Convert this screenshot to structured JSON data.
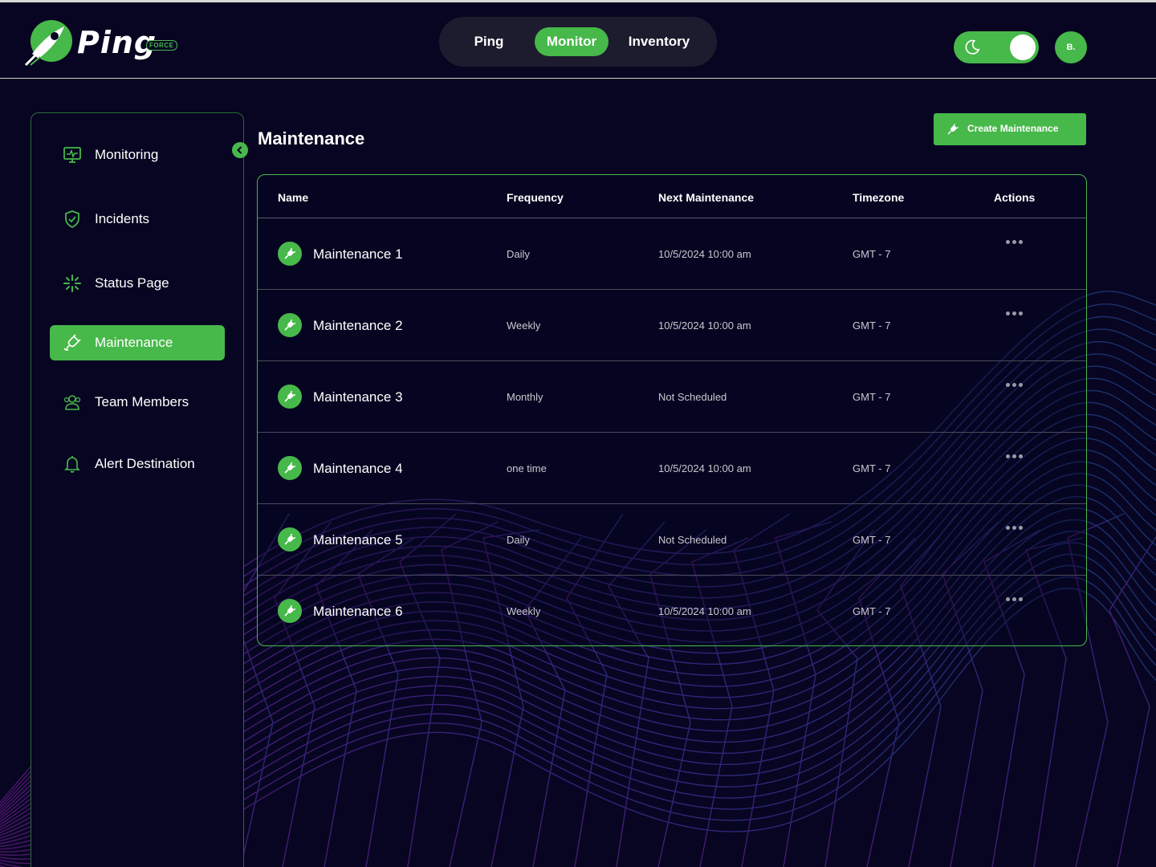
{
  "brand": {
    "name": "Ping",
    "tag": "FORCE",
    "accent": "#47b84a",
    "background": "#070521"
  },
  "nav": {
    "tabs": [
      {
        "label": "Ping",
        "active": false
      },
      {
        "label": "Monitor",
        "active": true
      },
      {
        "label": "Inventory",
        "active": false
      }
    ]
  },
  "theme_toggle": {
    "icon": "moon-icon",
    "state": "on"
  },
  "user": {
    "initial": "B."
  },
  "sidebar": {
    "items": [
      {
        "label": "Monitoring",
        "icon": "monitor-icon",
        "active": false
      },
      {
        "label": "Incidents",
        "icon": "shield-check-icon",
        "active": false
      },
      {
        "label": "Status Page",
        "icon": "status-burst-icon",
        "active": false
      },
      {
        "label": "Maintenance",
        "icon": "plug-icon",
        "active": true
      },
      {
        "label": "Team Members",
        "icon": "team-icon",
        "active": false
      },
      {
        "label": "Alert Destination",
        "icon": "bell-icon",
        "active": false
      }
    ]
  },
  "main": {
    "title": "Maintenance",
    "create_button": "Create Maintenance",
    "table": {
      "headers": [
        "Name",
        "Frequency",
        "Next Maintenance",
        "Timezone",
        "Actions"
      ],
      "rows": [
        {
          "name": "Maintenance 1",
          "frequency": "Daily",
          "next": "10/5/2024 10:00 am",
          "timezone": "GMT - 7"
        },
        {
          "name": "Maintenance 2",
          "frequency": "Weekly",
          "next": "10/5/2024 10:00 am",
          "timezone": "GMT - 7"
        },
        {
          "name": "Maintenance 3",
          "frequency": "Monthly",
          "next": "Not Scheduled",
          "timezone": "GMT - 7"
        },
        {
          "name": "Maintenance 4",
          "frequency": "one time",
          "next": "10/5/2024 10:00 am",
          "timezone": "GMT - 7"
        },
        {
          "name": "Maintenance 5",
          "frequency": "Daily",
          "next": "Not Scheduled",
          "timezone": "GMT - 7"
        },
        {
          "name": "Maintenance 6",
          "frequency": "Weekly",
          "next": "10/5/2024 10:00 am",
          "timezone": "GMT - 7"
        }
      ]
    }
  }
}
